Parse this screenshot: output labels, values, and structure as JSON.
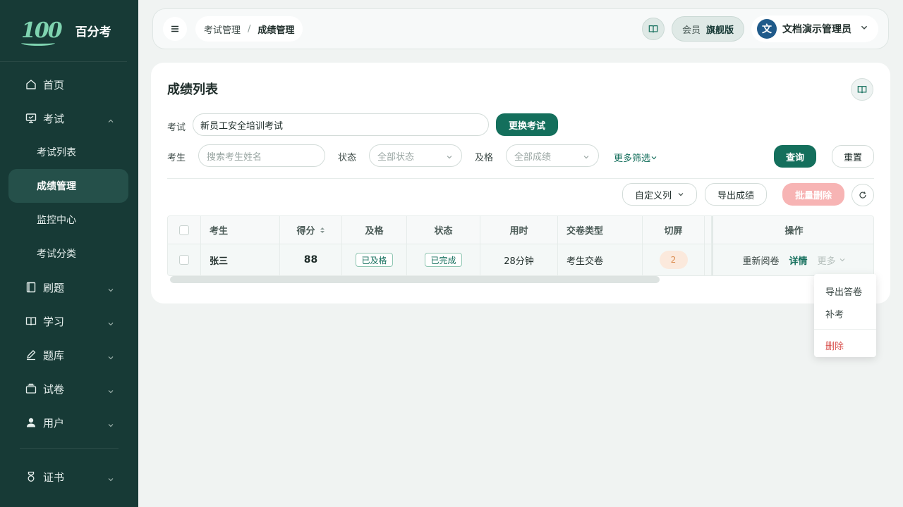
{
  "sidebar": {
    "brand_logo": "100",
    "brand_name": "百分考",
    "items": [
      {
        "label": "首页",
        "icon": "home-icon"
      },
      {
        "label": "考试",
        "icon": "monitor-icon",
        "expanded": true,
        "children": [
          {
            "label": "考试列表"
          },
          {
            "label": "成绩管理",
            "active": true
          },
          {
            "label": "监控中心"
          },
          {
            "label": "考试分类"
          }
        ]
      },
      {
        "label": "刷题",
        "icon": "notebook-icon"
      },
      {
        "label": "学习",
        "icon": "book-icon"
      },
      {
        "label": "题库",
        "icon": "pen-icon"
      },
      {
        "label": "试卷",
        "icon": "tray-icon"
      },
      {
        "label": "用户",
        "icon": "user-icon"
      },
      {
        "label": "证书",
        "icon": "medal-icon"
      }
    ]
  },
  "topbar": {
    "breadcrumb": [
      "考试管理",
      "成绩管理"
    ],
    "breadcrumb_sep": "/",
    "member_label": "会员",
    "member_level": "旗舰版",
    "avatar_initial": "文",
    "user_name": "文档演示管理员"
  },
  "page": {
    "title": "成绩列表",
    "exam_label": "考试",
    "exam_value": "新员工安全培训考试",
    "change_exam": "更换考试",
    "examinee_label": "考生",
    "examinee_placeholder": "搜索考生姓名",
    "status_label": "状态",
    "status_value": "全部状态",
    "pass_label": "及格",
    "pass_value": "全部成绩",
    "more_filter": "更多筛选",
    "query": "查询",
    "reset": "重置",
    "custom_columns": "自定义列",
    "export": "导出成绩",
    "batch_delete": "批量删除"
  },
  "table": {
    "headers": [
      "考生",
      "得分",
      "及格",
      "状态",
      "用时",
      "交卷类型",
      "切屏",
      "操作"
    ],
    "rows": [
      {
        "name": "张三",
        "score": "88",
        "pass": "已及格",
        "status": "已完成",
        "time": "28分钟",
        "type": "考生交卷",
        "switch": "2",
        "ops": [
          "重新阅卷",
          "详情",
          "更多"
        ]
      }
    ]
  },
  "dropdown": {
    "items": [
      "导出答卷",
      "补考"
    ],
    "danger": "删除"
  },
  "colors": {
    "sidebar_bg": "#173a36",
    "primary": "#146f5c",
    "danger_light": "#f7b4b4",
    "danger": "#d9534f"
  }
}
